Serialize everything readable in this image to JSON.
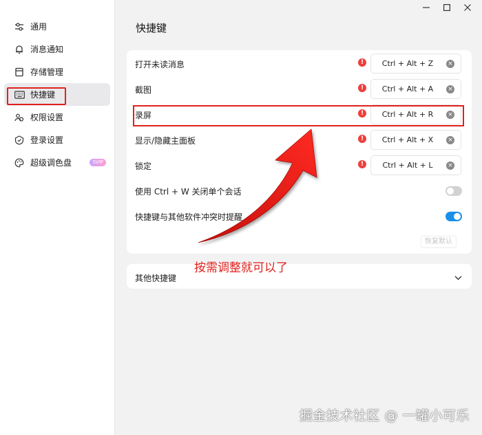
{
  "sidebar": {
    "items": [
      {
        "label": "通用",
        "icon": "sliders-icon"
      },
      {
        "label": "消息通知",
        "icon": "bell-icon"
      },
      {
        "label": "存储管理",
        "icon": "storage-icon"
      },
      {
        "label": "快捷键",
        "icon": "keyboard-icon",
        "active": true
      },
      {
        "label": "权限设置",
        "icon": "users-icon"
      },
      {
        "label": "登录设置",
        "icon": "shield-icon"
      },
      {
        "label": "超级调色盘",
        "icon": "palette-icon",
        "badge": "SVIP"
      }
    ]
  },
  "page_title": "快捷键",
  "shortcuts": [
    {
      "label": "打开未读消息",
      "warn": "!",
      "key": "Ctrl + Alt + Z",
      "clear": "×"
    },
    {
      "label": "截图",
      "warn": "!",
      "key": "Ctrl + Alt + A",
      "clear": "×"
    },
    {
      "label": "录屏",
      "warn": "!",
      "key": "Ctrl + Alt + R",
      "clear": "×"
    },
    {
      "label": "显示/隐藏主面板",
      "warn": "!",
      "key": "Ctrl + Alt + X",
      "clear": "×"
    },
    {
      "label": "锁定",
      "warn": "!",
      "key": "Ctrl + Alt + L",
      "clear": "×"
    }
  ],
  "toggles": [
    {
      "label": "使用 Ctrl + W 关闭单个会话",
      "on": false
    },
    {
      "label": "快捷键与其他软件冲突时提醒",
      "on": true
    }
  ],
  "restore_label": "恢复默认",
  "other_shortcuts_label": "其他快捷键",
  "annotation": "按需调整就可以了",
  "watermark": "掘金技术社区 @ 一罐小可乐",
  "colors": {
    "accent_blue": "#1a8fe8",
    "highlight_red": "#e0201c",
    "warn_red": "#ee3f3b"
  }
}
